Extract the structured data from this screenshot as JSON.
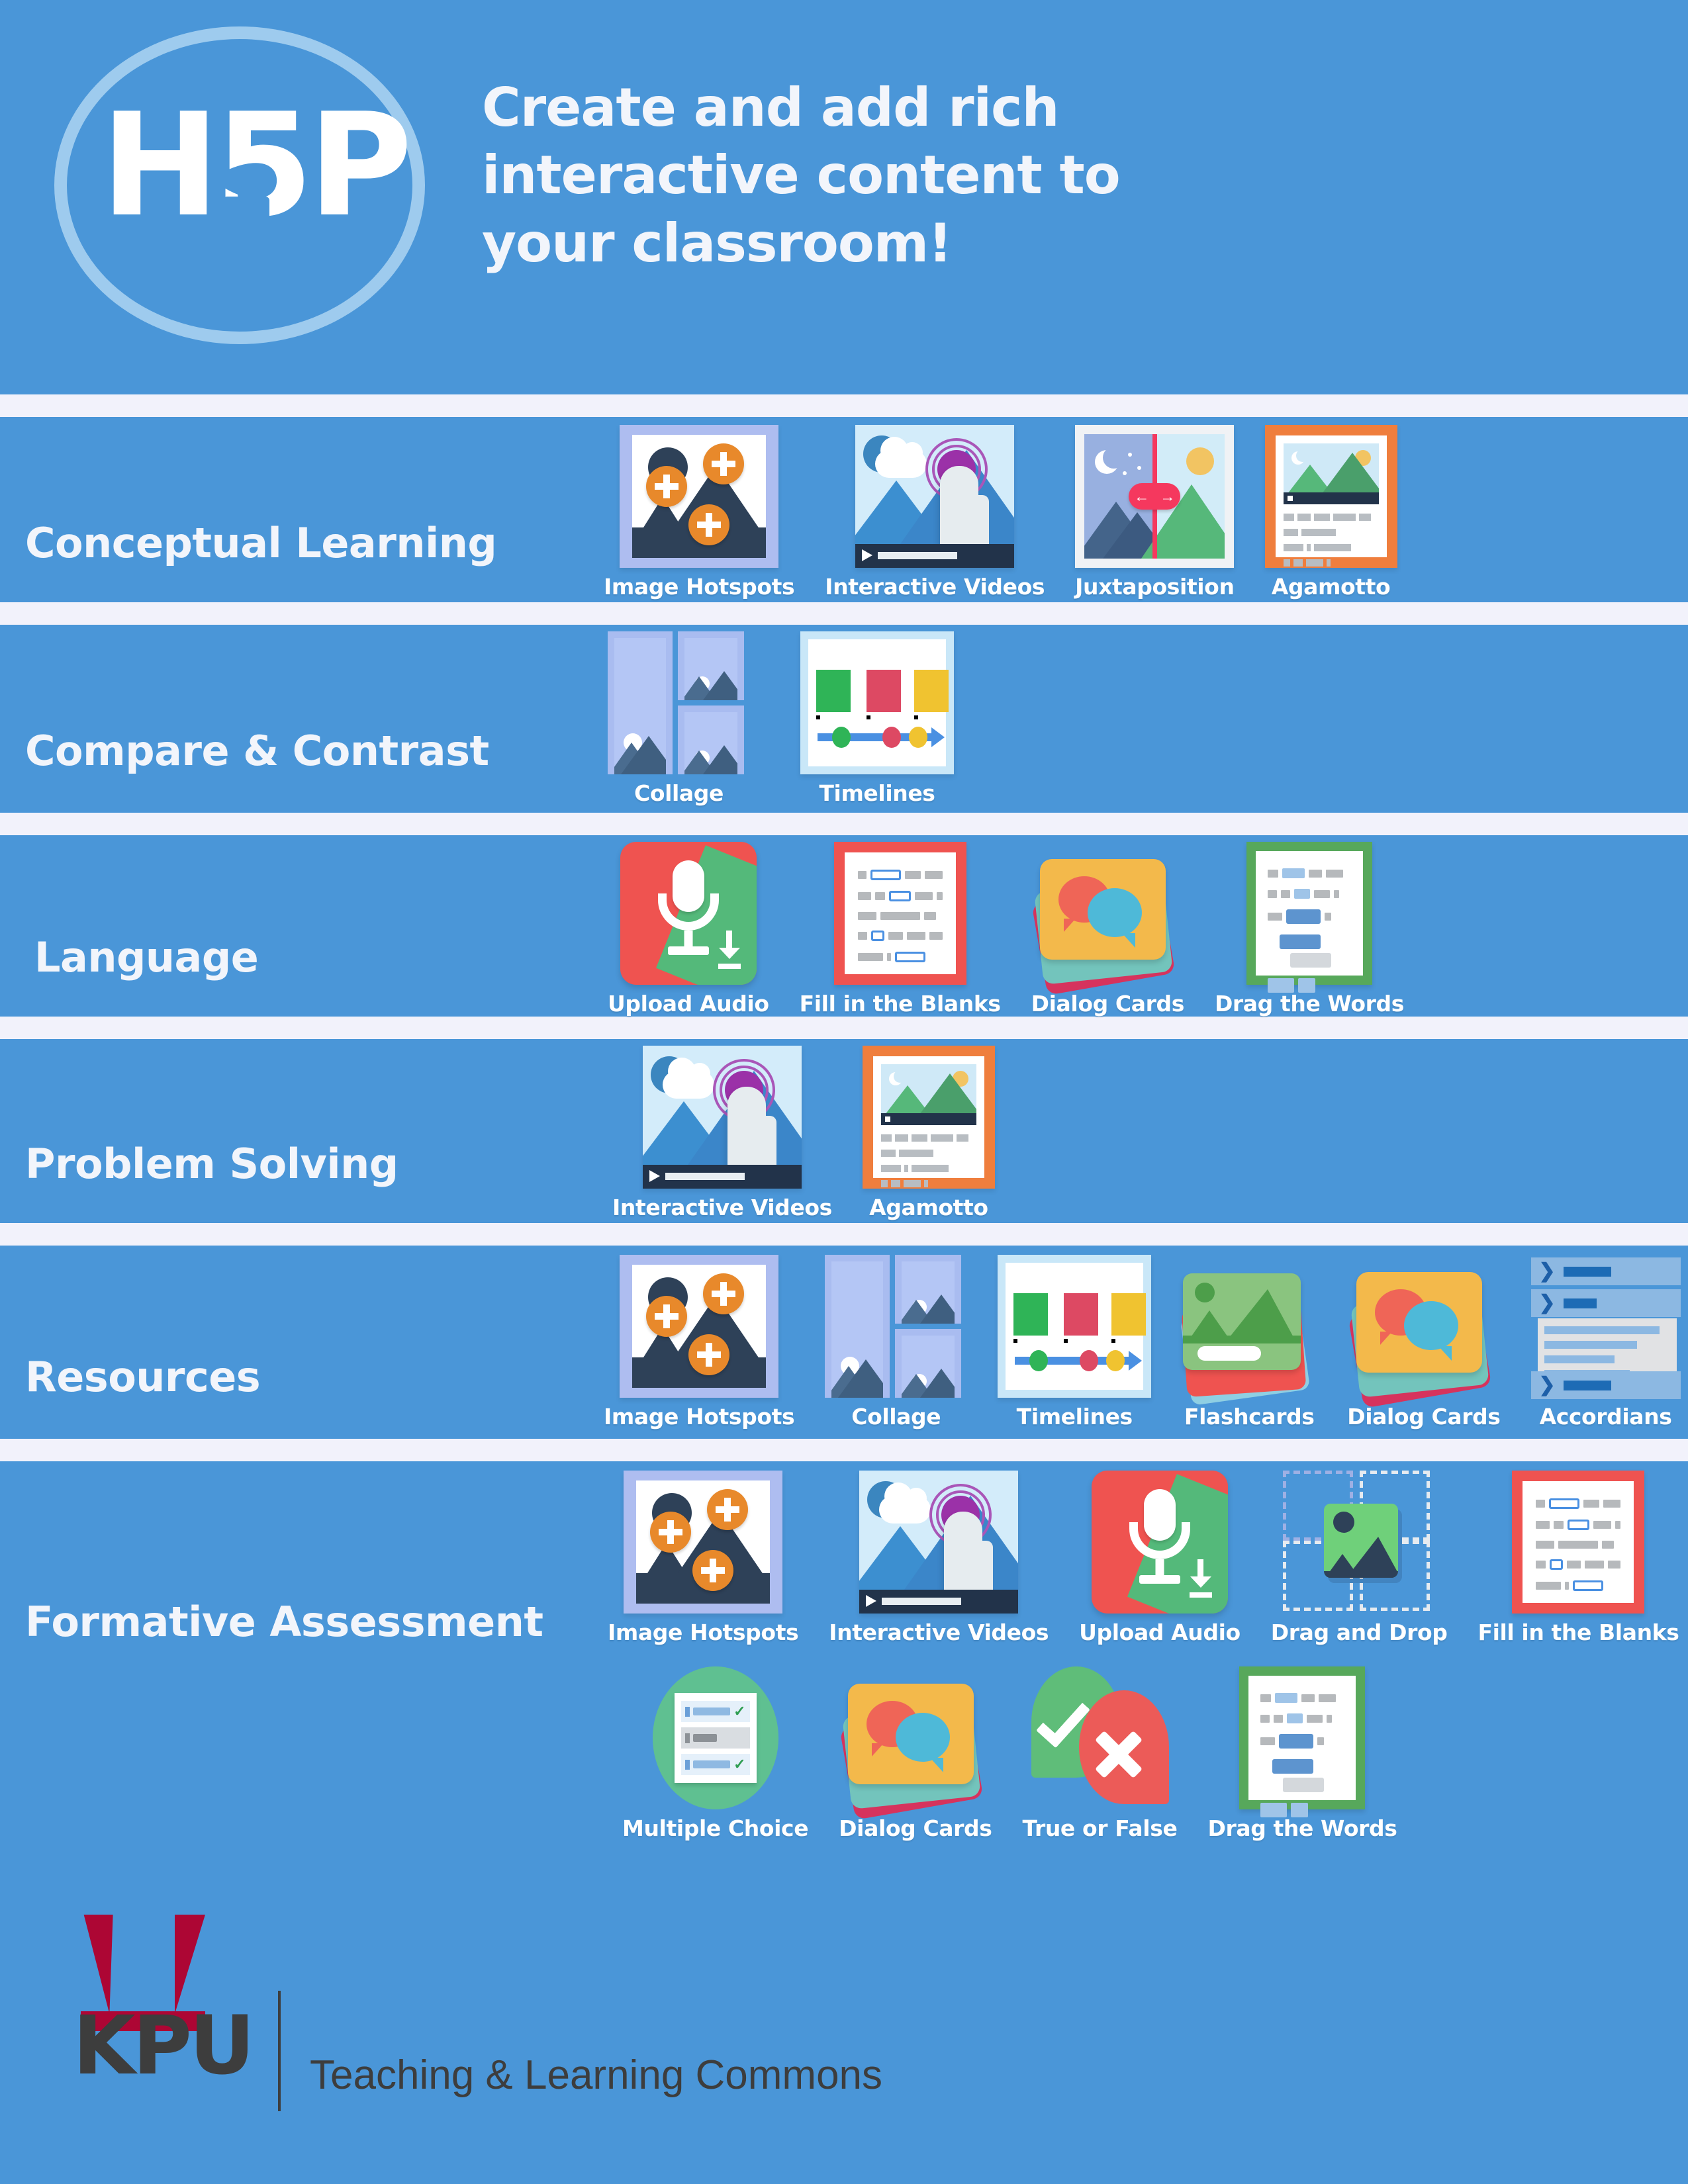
{
  "header": {
    "logo_text": "H5P",
    "headline_line1": "Create and add rich",
    "headline_line2": "interactive content to",
    "headline_line3": "your classroom!"
  },
  "colors": {
    "background_blue": "#4a96d8",
    "separator_white": "#f2f2fb",
    "orange_accent": "#e8892b",
    "red_accent": "#ef5350",
    "green_accent": "#57a85b",
    "kpu_red": "#ad0634",
    "kpu_dark": "#3d3d3d"
  },
  "rows": [
    {
      "title": "Conceptual Learning",
      "tiles": [
        {
          "label": "Image Hotspots",
          "icon": "image-hotspots-icon"
        },
        {
          "label": "Interactive Videos",
          "icon": "interactive-videos-icon"
        },
        {
          "label": "Juxtaposition",
          "icon": "juxtaposition-icon"
        },
        {
          "label": "Agamotto",
          "icon": "agamotto-icon"
        }
      ]
    },
    {
      "title": "Compare & Contrast",
      "tiles": [
        {
          "label": "Collage",
          "icon": "collage-icon"
        },
        {
          "label": "Timelines",
          "icon": "timelines-icon"
        }
      ]
    },
    {
      "title": "Language",
      "tiles": [
        {
          "label": "Upload Audio",
          "icon": "upload-audio-icon"
        },
        {
          "label": "Fill in the Blanks",
          "icon": "fill-in-the-blanks-icon"
        },
        {
          "label": "Dialog Cards",
          "icon": "dialog-cards-icon"
        },
        {
          "label": "Drag the Words",
          "icon": "drag-the-words-icon"
        }
      ]
    },
    {
      "title": "Problem Solving",
      "tiles": [
        {
          "label": "Interactive Videos",
          "icon": "interactive-videos-icon"
        },
        {
          "label": "Agamotto",
          "icon": "agamotto-icon"
        }
      ]
    },
    {
      "title": "Resources",
      "tiles": [
        {
          "label": "Image Hotspots",
          "icon": "image-hotspots-icon"
        },
        {
          "label": "Collage",
          "icon": "collage-icon"
        },
        {
          "label": "Timelines",
          "icon": "timelines-icon"
        },
        {
          "label": "Flashcards",
          "icon": "flashcards-icon"
        },
        {
          "label": "Dialog Cards",
          "icon": "dialog-cards-icon"
        },
        {
          "label": "Accordians",
          "icon": "accordion-icon"
        }
      ]
    },
    {
      "title": "Formative Assessment",
      "tiles": [
        {
          "label": "Image Hotspots",
          "icon": "image-hotspots-icon"
        },
        {
          "label": "Interactive Videos",
          "icon": "interactive-videos-icon"
        },
        {
          "label": "Upload Audio",
          "icon": "upload-audio-icon"
        },
        {
          "label": "Drag and Drop",
          "icon": "drag-and-drop-icon"
        },
        {
          "label": "Fill in the Blanks",
          "icon": "fill-in-the-blanks-icon"
        }
      ],
      "tiles_row2": [
        {
          "label": "Multiple Choice",
          "icon": "multiple-choice-icon"
        },
        {
          "label": "Dialog Cards",
          "icon": "dialog-cards-icon"
        },
        {
          "label": "True or False",
          "icon": "true-or-false-icon"
        },
        {
          "label": "Drag the Words",
          "icon": "drag-the-words-icon"
        }
      ]
    }
  ],
  "footer": {
    "logo_letters": "KPU",
    "tagline": "Teaching & Learning Commons"
  }
}
